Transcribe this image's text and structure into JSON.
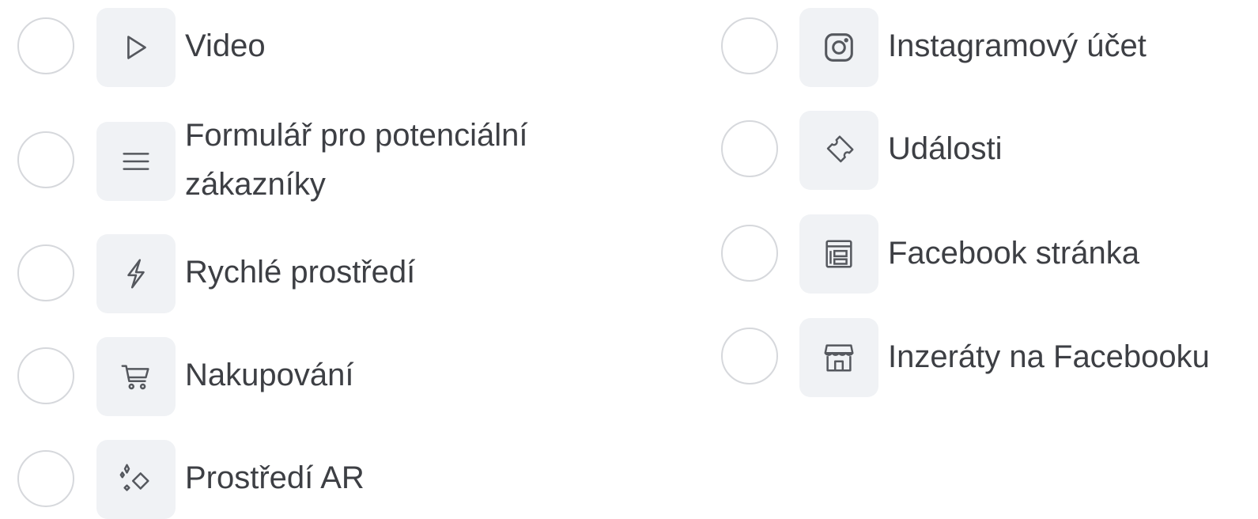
{
  "options_left": [
    {
      "label": "Video",
      "icon": "play-icon"
    },
    {
      "label": "Formulář pro potenciální zákazníky",
      "icon": "menu-lines-icon"
    },
    {
      "label": "Rychlé prostředí",
      "icon": "lightning-icon"
    },
    {
      "label": "Nakupování",
      "icon": "shopping-cart-icon"
    },
    {
      "label": "Prostředí AR",
      "icon": "sparkles-icon"
    }
  ],
  "options_right": [
    {
      "label": "Instagramový účet",
      "icon": "instagram-icon"
    },
    {
      "label": "Události",
      "icon": "ticket-icon"
    },
    {
      "label": "Facebook stránka",
      "icon": "facebook-page-icon"
    },
    {
      "label": "Inzeráty na Facebooku",
      "icon": "storefront-icon"
    }
  ],
  "colors": {
    "radio_border": "#d6d8dc",
    "icon_background": "#f0f2f5",
    "icon_stroke": "#55585e",
    "text": "#3d3f44"
  }
}
